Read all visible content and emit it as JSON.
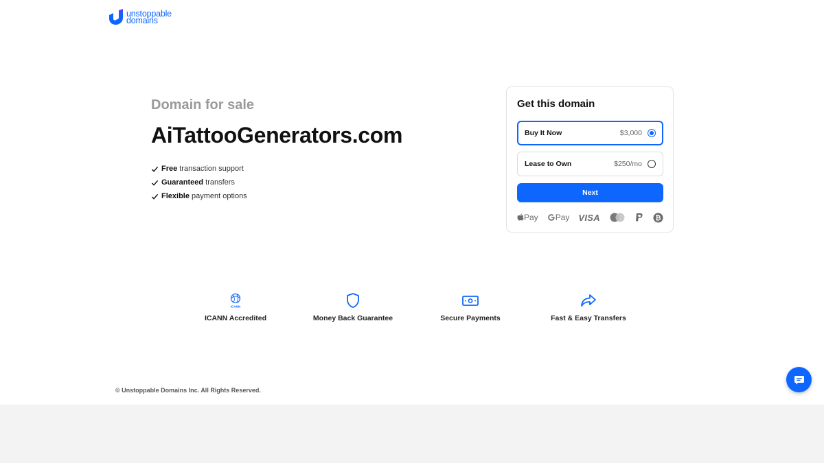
{
  "brand": {
    "line1": "unstoppable",
    "line2": "domains",
    "color": "#0d67fe"
  },
  "hero": {
    "subtitle": "Domain for sale",
    "domain": "AiTattooGenerators.com",
    "features": [
      {
        "bold": "Free",
        "rest": "transaction support"
      },
      {
        "bold": "Guaranteed",
        "rest": "transfers"
      },
      {
        "bold": "Flexible",
        "rest": "payment options"
      }
    ]
  },
  "card": {
    "title": "Get this domain",
    "options": [
      {
        "label": "Buy It Now",
        "price": "$3,000",
        "selected": true
      },
      {
        "label": "Lease to Own",
        "price": "$250/mo",
        "selected": false
      }
    ],
    "next_label": "Next",
    "payments": {
      "apple_pay": "Pay",
      "google_pay": "Pay",
      "visa": "VISA",
      "icons": [
        "apple-pay-icon",
        "google-pay-icon",
        "visa-icon",
        "mastercard-icon",
        "paypal-icon",
        "bitcoin-icon"
      ]
    }
  },
  "trust": [
    {
      "label": "ICANN Accredited",
      "icon": "icann-icon",
      "icon_text": "ICANN"
    },
    {
      "label": "Money Back Guarantee",
      "icon": "shield-icon"
    },
    {
      "label": "Secure Payments",
      "icon": "money-icon"
    },
    {
      "label": "Fast & Easy Transfers",
      "icon": "share-arrow-icon"
    }
  ],
  "footer": {
    "copyright": "© Unstoppable Domains Inc. All Rights Reserved."
  },
  "chat": {
    "icon": "chat-icon"
  }
}
